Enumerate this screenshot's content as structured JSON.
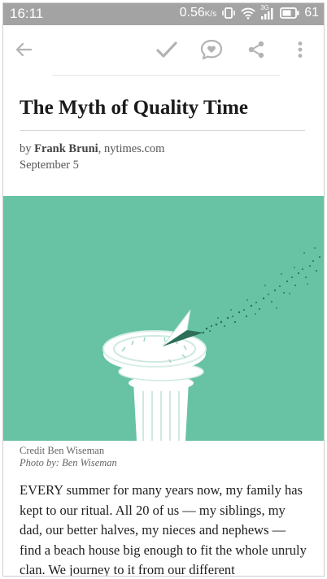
{
  "status_bar": {
    "time": "16:11",
    "speed": "0.56",
    "speed_unit": "K/s",
    "network": "3G",
    "battery": "61"
  },
  "toolbar": {
    "back_icon": "arrow-left-icon",
    "archive_icon": "checkmark-icon",
    "favorite_icon": "heart-bubble-icon",
    "share_icon": "share-icon",
    "menu_icon": "more-vertical-icon"
  },
  "article": {
    "title": "The Myth of Quality Time",
    "byline_prefix": "by ",
    "author": "Frank Bruni",
    "byline_sep": ", ",
    "source": "nytimes.com",
    "date": "September 5",
    "image_credit": "Credit Ben Wiseman",
    "image_photo_by": "Photo by: Ben Wiseman",
    "image_bg_color": "#67c3a3",
    "body": "EVERY summer for many years now, my family has kept to our ritual. All 20 of us — my siblings, my dad, our better halves, my nieces and nephews — find a beach house big enough to fit the whole unruly clan. We journey to it from our different"
  }
}
